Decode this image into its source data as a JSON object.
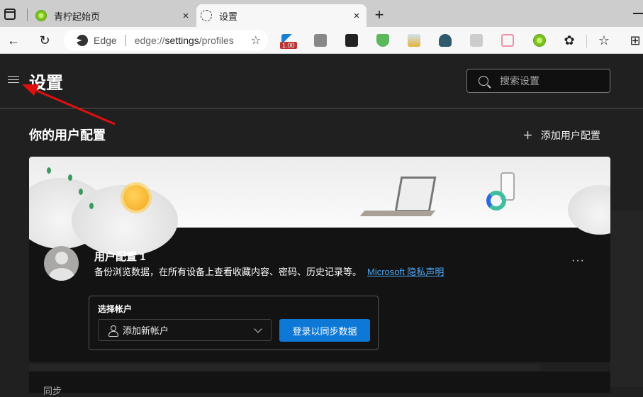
{
  "browser": {
    "tabs": [
      {
        "title": "青柠起始页",
        "icon": "lime-icon",
        "active": false
      },
      {
        "title": "设置",
        "icon": "gear-icon",
        "active": true
      }
    ],
    "close_glyph": "×",
    "new_tab_glyph": "+",
    "address": {
      "site_label": "Edge",
      "url_prefix": "edge://",
      "url_host": "settings",
      "url_path": "/profiles"
    },
    "extension_badge": "1.00",
    "extensions": [
      "video-speed-icon",
      "tampermonkey-icon",
      "lastpass-icon",
      "adguard-icon",
      "image-downloader-icon",
      "spy-icon",
      "copy-icon",
      "tv-icon",
      "lime-icon",
      "extensions-icon",
      "favorites-icon",
      "collections-icon"
    ]
  },
  "settings": {
    "title": "设置",
    "search_placeholder": "搜索设置",
    "section_title": "你的用户配置",
    "add_profile_label": "添加用户配置",
    "profile": {
      "name": "用户配置 1",
      "description": "备份浏览数据，在所有设备上查看收藏内容、密码、历史记录等。",
      "privacy_link": "Microsoft 隐私声明",
      "more_glyph": "···"
    },
    "account": {
      "label": "选择帐户",
      "select_value": "添加新帐户",
      "sync_button": "登录以同步数据"
    },
    "next_section_label": "同步"
  },
  "colors": {
    "accent": "#0e78d6",
    "link": "#4ba3f0",
    "annotation_arrow": "#e01010"
  }
}
